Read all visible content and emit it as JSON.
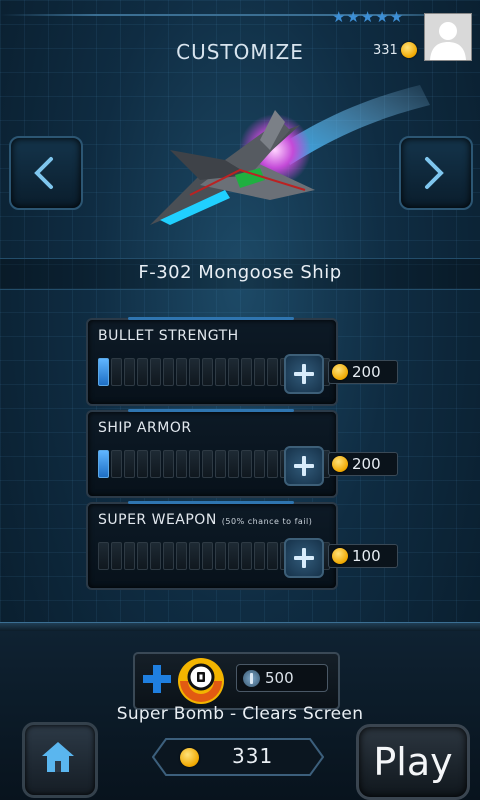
{
  "header": {
    "title": "CUSTOMIZE",
    "stars": "★★★★★",
    "coins": "331"
  },
  "ship": {
    "name": "F-302 Mongoose Ship"
  },
  "upgrades": [
    {
      "label": "BULLET STRENGTH",
      "note": "",
      "level": 1,
      "max_level": 18,
      "cost": "200"
    },
    {
      "label": "SHIP ARMOR",
      "note": "",
      "level": 1,
      "max_level": 18,
      "cost": "200"
    },
    {
      "label": "SUPER WEAPON",
      "note": "(50% chance to fail)",
      "level": 0,
      "max_level": 18,
      "cost": "100"
    }
  ],
  "powerup": {
    "cost": "500",
    "caption": "Super Bomb - Clears Screen"
  },
  "footer": {
    "coins": "331",
    "play_label": "Play"
  },
  "colors": {
    "accent": "#3d8fd6",
    "bar_on": "#5fb5ff",
    "coin": "#f0a800"
  }
}
